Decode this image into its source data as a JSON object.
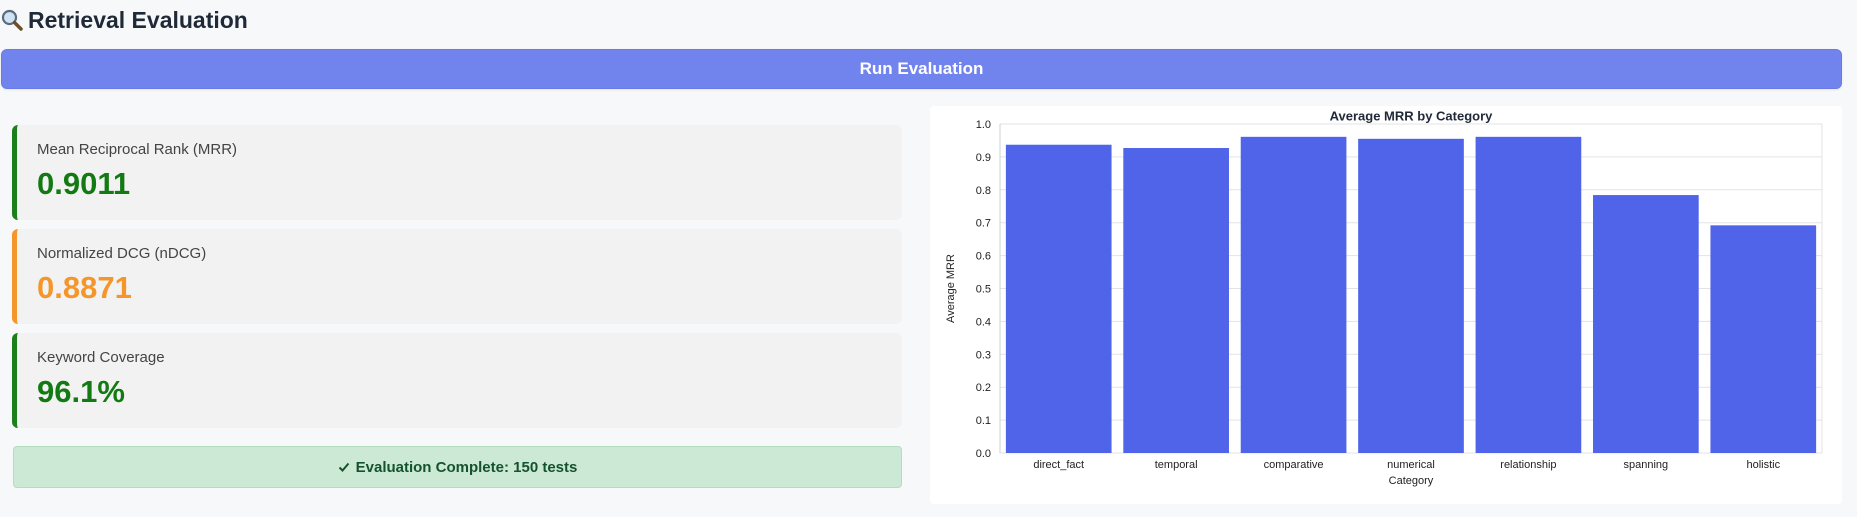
{
  "header": {
    "title": "Retrieval Evaluation",
    "icon": "magnifying-glass-icon"
  },
  "run_button": {
    "label": "Run Evaluation"
  },
  "metrics": [
    {
      "label": "Mean Reciprocal Rank (MRR)",
      "value": "0.9011",
      "color": "#137a13"
    },
    {
      "label": "Normalized DCG (nDCG)",
      "value": "0.8871",
      "color": "#f5962a"
    },
    {
      "label": "Keyword Coverage",
      "value": "96.1%",
      "color": "#137a13"
    }
  ],
  "status": {
    "text": "Evaluation Complete: 150 tests",
    "icon": "checkmark-icon"
  },
  "chart_data": {
    "type": "bar",
    "title": "Average MRR by Category",
    "xlabel": "Category",
    "ylabel": "Average MRR",
    "categories": [
      "direct_fact",
      "temporal",
      "comparative",
      "numerical",
      "relationship",
      "spanning",
      "holistic"
    ],
    "values": [
      0.937,
      0.927,
      0.961,
      0.955,
      0.961,
      0.784,
      0.692
    ],
    "ylim": [
      0,
      1.0
    ],
    "yticks": [
      "0.0",
      "0.1",
      "0.2",
      "0.3",
      "0.4",
      "0.5",
      "0.6",
      "0.7",
      "0.8",
      "0.9",
      "1.0"
    ],
    "grid": true,
    "bar_color": "#5064ea"
  }
}
